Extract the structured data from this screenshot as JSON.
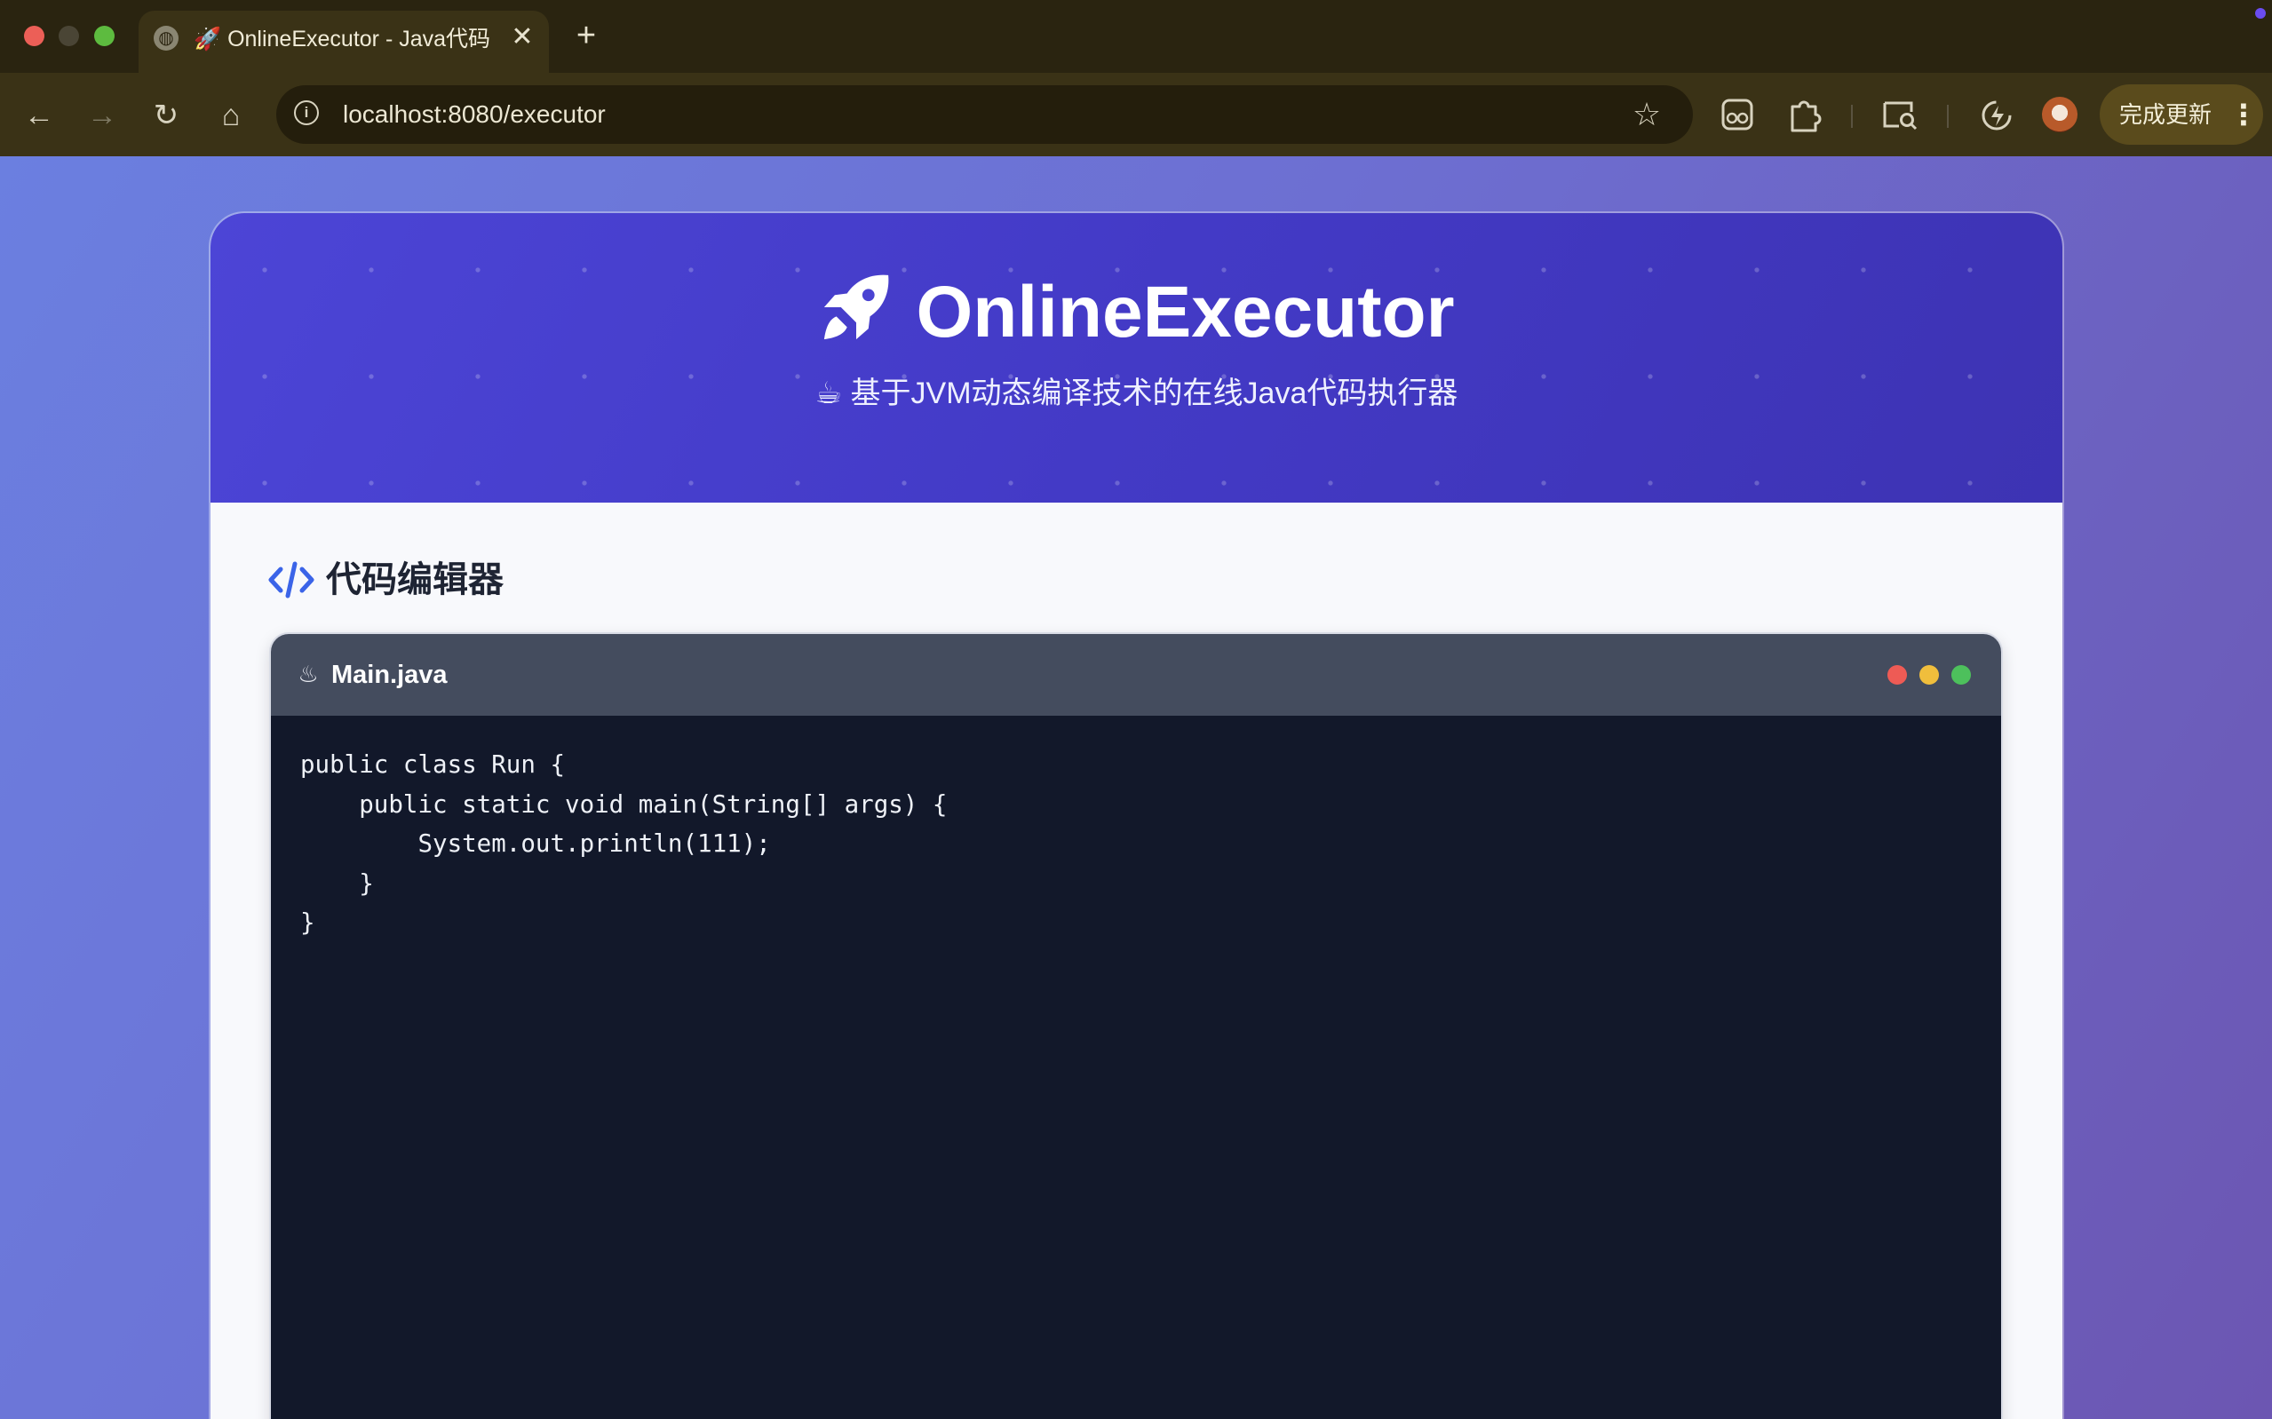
{
  "browser": {
    "tab": {
      "title": "🚀 OnlineExecutor - Java代码",
      "close_glyph": "✕"
    },
    "new_tab_glyph": "+",
    "nav": {
      "back": "←",
      "forward": "→",
      "reload": "↻",
      "home": "⌂"
    },
    "address": {
      "info_glyph": "i",
      "url": "localhost:8080/executor",
      "bookmark_glyph": "☆"
    },
    "update_button": {
      "label": "完成更新",
      "menu_glyph": "⋮"
    }
  },
  "page": {
    "hero": {
      "title": "OnlineExecutor",
      "subtitle": "☕ 基于JVM动态编译技术的在线Java代码执行器"
    },
    "editor_section": {
      "title": "代码编辑器"
    },
    "editor": {
      "file_icon": "♨",
      "file_name": "Main.java",
      "code_lines": [
        "public class Run {",
        "    public static void main(String[] args) {",
        "        System.out.println(111);",
        "    }",
        "}"
      ]
    }
  },
  "colors": {
    "brand_gradient_start": "#6b7fe0",
    "brand_gradient_end": "#6c56b2",
    "hero": "#4c45d6",
    "code_background": "#12182a",
    "accent_icon": "#3b64e8"
  }
}
